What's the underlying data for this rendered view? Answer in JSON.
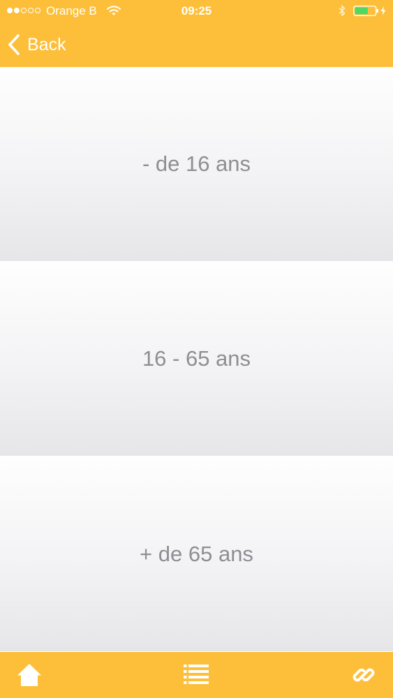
{
  "status_bar": {
    "carrier": "Orange B",
    "time": "09:25",
    "signal_bars_filled": 2,
    "signal_bars_total": 5,
    "battery_level": 0.65,
    "icons": [
      "wifi-icon",
      "bluetooth-icon",
      "battery-icon",
      "charging-icon"
    ]
  },
  "nav": {
    "back_label": "Back",
    "back_icon": "chevron-left-icon"
  },
  "options": [
    {
      "label": "- de 16 ans"
    },
    {
      "label": "16 - 65 ans"
    },
    {
      "label": "+ de 65 ans"
    }
  ],
  "tab_bar": {
    "items": [
      {
        "icon": "home-icon"
      },
      {
        "icon": "list-icon"
      },
      {
        "icon": "link-icon"
      }
    ]
  },
  "colors": {
    "accent": "#FDBF3A",
    "option_text": "#8e8e93",
    "bar_text": "#ffffff"
  }
}
